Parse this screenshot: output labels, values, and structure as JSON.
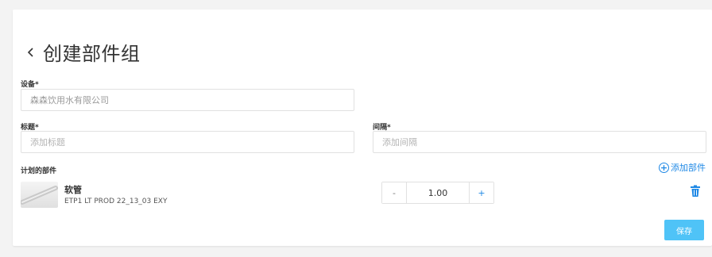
{
  "header": {
    "title": "创建部件组",
    "back_icon": "chevron-left-icon"
  },
  "form": {
    "device": {
      "label": "设备*",
      "value": "森森饮用水有限公司"
    },
    "title": {
      "label": "标题*",
      "placeholder": "添加标题"
    },
    "interval": {
      "label": "间隔*",
      "placeholder": "添加间隔"
    }
  },
  "planned_parts": {
    "label": "计划的部件",
    "add_label": "添加部件",
    "add_icon": "plus-circle-icon",
    "items": [
      {
        "name": "软管",
        "code": "ETP1 LT PROD 22_13_03 EXY",
        "quantity": "1.00",
        "minus": "-",
        "plus": "+",
        "delete_icon": "trash-icon"
      }
    ]
  },
  "actions": {
    "save_label": "保存"
  },
  "colors": {
    "accent": "#1e88e5",
    "save_bg": "#4fc3f7",
    "page_bg": "#f3f3f3"
  }
}
